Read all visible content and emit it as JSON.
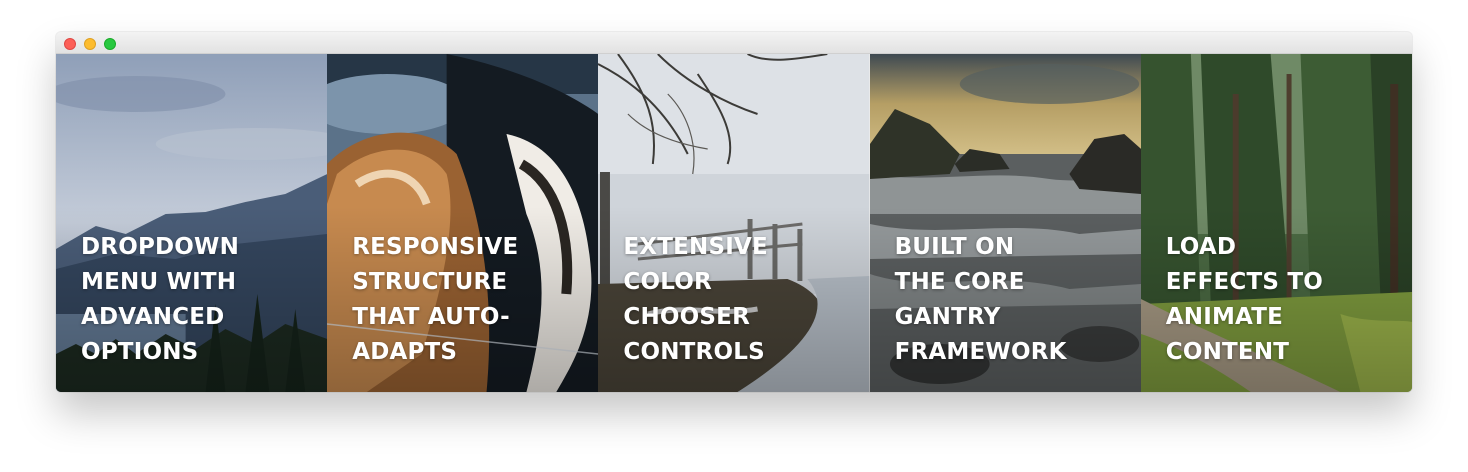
{
  "window": {
    "controls": {
      "close": "close-button",
      "minimize": "minimize-button",
      "maximize": "maximize-button"
    }
  },
  "panels": [
    {
      "lines": [
        "DROPDOWN",
        "MENU WITH",
        "ADVANCED",
        "OPTIONS"
      ],
      "image": "mountain-lake-photo"
    },
    {
      "lines": [
        "RESPONSIVE",
        "STRUCTURE",
        "THAT AUTO-",
        "ADAPTS"
      ],
      "image": "horses-photo"
    },
    {
      "lines": [
        "EXTENSIVE",
        "COLOR",
        "CHOOSER",
        "CONTROLS"
      ],
      "image": "foggy-fence-photo"
    },
    {
      "lines": [
        "BUILT ON",
        "THE CORE",
        "GANTRY",
        "FRAMEWORK"
      ],
      "image": "sea-rocks-photo"
    },
    {
      "lines": [
        "LOAD",
        "EFFECTS TO",
        "ANIMATE",
        "CONTENT"
      ],
      "image": "forest-path-photo"
    }
  ],
  "colors": {
    "caption_text": "#ffffff",
    "titlebar": "#e8e8e8"
  }
}
